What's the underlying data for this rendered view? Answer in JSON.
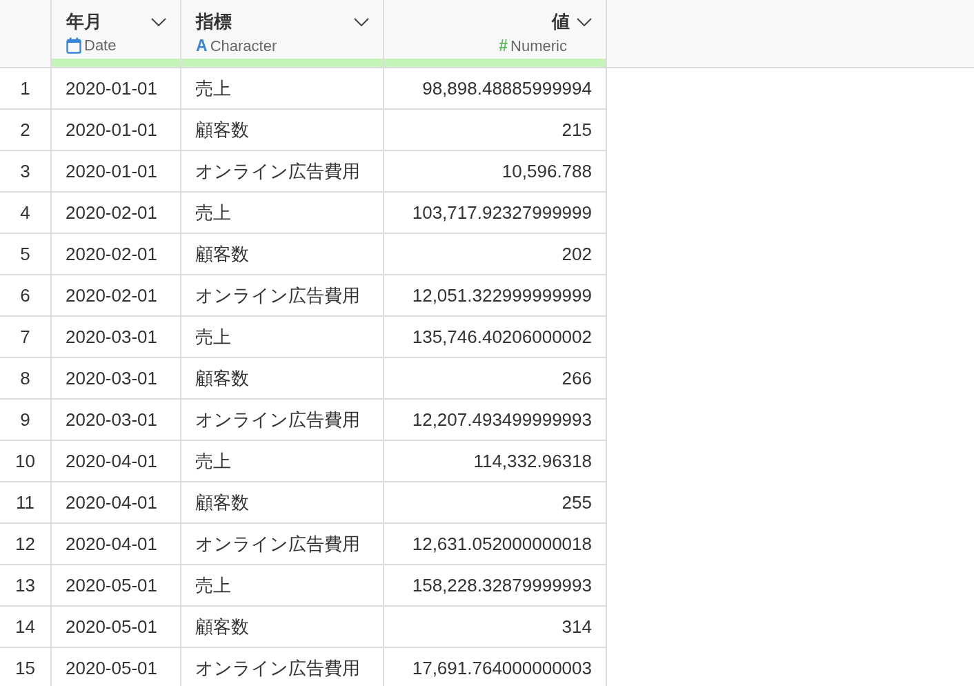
{
  "columns": [
    {
      "title": "年月",
      "kind": "date",
      "type_label": "Date",
      "level": 1
    },
    {
      "title": "指標",
      "kind": "character",
      "type_icon": "A",
      "type_label": "Character",
      "level": 1
    },
    {
      "title": "値",
      "kind": "numeric",
      "type_icon": "#",
      "type_label": "Numeric",
      "level": 1
    }
  ],
  "rows": [
    {
      "number": "1",
      "cells": [
        "2020-01-01",
        "売上",
        "98,898.48885999994"
      ]
    },
    {
      "number": "2",
      "cells": [
        "2020-01-01",
        "顧客数",
        "215"
      ]
    },
    {
      "number": "3",
      "cells": [
        "2020-01-01",
        "オンライン広告費用",
        "10,596.788"
      ]
    },
    {
      "number": "4",
      "cells": [
        "2020-02-01",
        "売上",
        "103,717.92327999999"
      ]
    },
    {
      "number": "5",
      "cells": [
        "2020-02-01",
        "顧客数",
        "202"
      ]
    },
    {
      "number": "6",
      "cells": [
        "2020-02-01",
        "オンライン広告費用",
        "12,051.322999999999"
      ]
    },
    {
      "number": "7",
      "cells": [
        "2020-03-01",
        "売上",
        "135,746.40206000002"
      ]
    },
    {
      "number": "8",
      "cells": [
        "2020-03-01",
        "顧客数",
        "266"
      ]
    },
    {
      "number": "9",
      "cells": [
        "2020-03-01",
        "オンライン広告費用",
        "12,207.493499999993"
      ]
    },
    {
      "number": "10",
      "cells": [
        "2020-04-01",
        "売上",
        "114,332.96318"
      ]
    },
    {
      "number": "11",
      "cells": [
        "2020-04-01",
        "顧客数",
        "255"
      ]
    },
    {
      "number": "12",
      "cells": [
        "2020-04-01",
        "オンライン広告費用",
        "12,631.052000000018"
      ]
    },
    {
      "number": "13",
      "cells": [
        "2020-05-01",
        "売上",
        "158,228.32879999993"
      ]
    },
    {
      "number": "14",
      "cells": [
        "2020-05-01",
        "顧客数",
        "314"
      ]
    },
    {
      "number": "15",
      "cells": [
        "2020-05-01",
        "オンライン広告費用",
        "17,691.764000000003"
      ]
    }
  ]
}
